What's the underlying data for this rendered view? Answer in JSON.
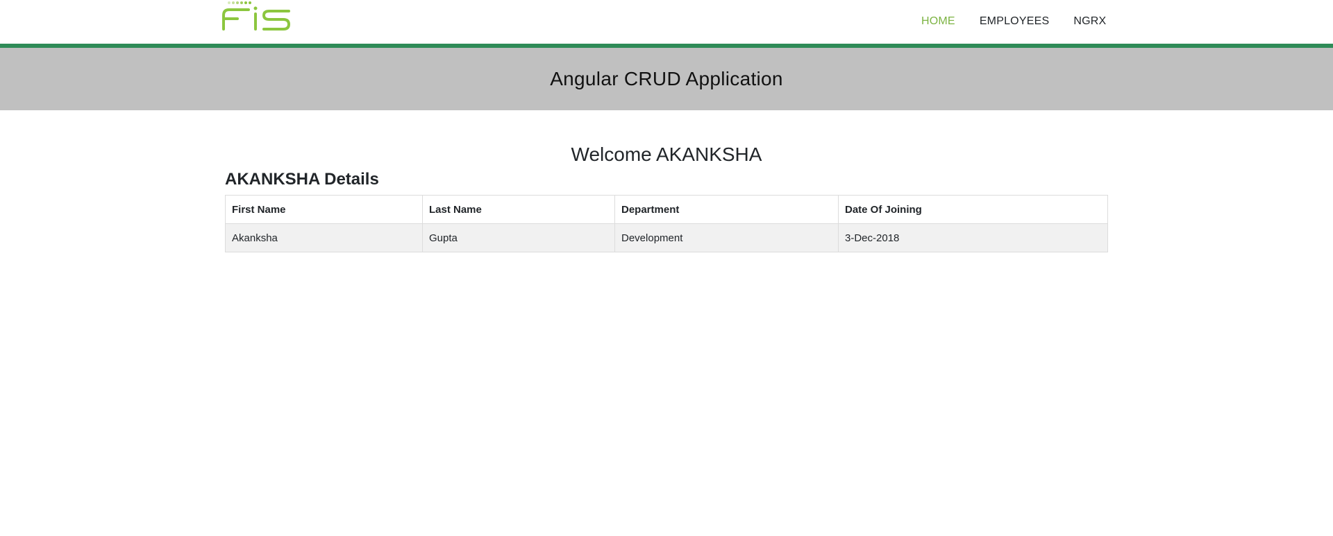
{
  "brand": {
    "logo_text": "FIS",
    "logo_color": "#8cc63f"
  },
  "nav": {
    "items": [
      {
        "label": "HOME",
        "active": true
      },
      {
        "label": "EMPLOYEES",
        "active": false
      },
      {
        "label": "NGRX",
        "active": false
      }
    ],
    "active_color": "#7cb342",
    "divider_color": "#2e8b57"
  },
  "banner": {
    "title": "Angular CRUD Application",
    "background": "#c0c0c0"
  },
  "main": {
    "welcome": "Welcome AKANKSHA",
    "details_heading": "AKANKSHA Details",
    "table": {
      "columns": [
        "First Name",
        "Last Name",
        "Department",
        "Date Of Joining"
      ],
      "rows": [
        [
          "Akanksha",
          "Gupta",
          "Development",
          "3-Dec-2018"
        ]
      ]
    }
  }
}
